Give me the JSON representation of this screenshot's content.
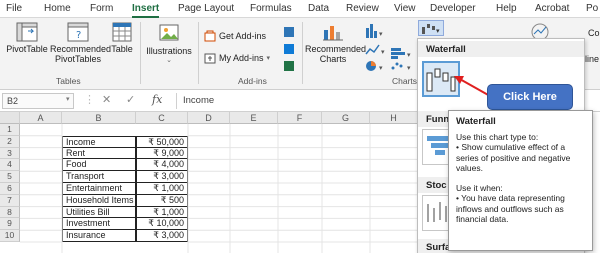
{
  "tabs": [
    "File",
    "Home",
    "Form",
    "Insert",
    "Page Layout",
    "Formulas",
    "Data",
    "Review",
    "View",
    "Developer",
    "Help",
    "Acrobat",
    "Po"
  ],
  "ribbon": {
    "pivottable": "PivotTable",
    "recommended_pivottables": "Recommended PivotTables",
    "table": "Table",
    "illustrations": "Illustrations",
    "get_addins": "Get Add-ins",
    "my_addins": "My Add-ins",
    "recommended_charts": "Recommended Charts",
    "groups": {
      "tables": "Tables",
      "addins": "Add-ins",
      "charts": "Charts"
    },
    "partial_line": "line",
    "partial_co": "Co"
  },
  "formula_bar": {
    "name_box": "B2",
    "cancel": "✕",
    "enter": "✓",
    "fx": "fx",
    "content": "Income"
  },
  "columns": [
    "A",
    "B",
    "C",
    "D",
    "E",
    "F",
    "G",
    "H"
  ],
  "rows": [
    "1",
    "2",
    "3",
    "4",
    "5",
    "6",
    "7",
    "8",
    "9",
    "10"
  ],
  "table": [
    {
      "label": "Income",
      "value": "₹ 50,000"
    },
    {
      "label": "Rent",
      "value": "₹ 9,000"
    },
    {
      "label": "Food",
      "value": "₹ 4,000"
    },
    {
      "label": "Transport",
      "value": "₹ 3,000"
    },
    {
      "label": "Entertainment",
      "value": "₹ 1,000"
    },
    {
      "label": "Household Items",
      "value": "₹ 500"
    },
    {
      "label": "Utilities Bill",
      "value": "₹ 1,000"
    },
    {
      "label": "Investment",
      "value": "₹ 10,000"
    },
    {
      "label": "Insurance",
      "value": "₹ 3,000"
    }
  ],
  "dropdown": {
    "waterfall": "Waterfall",
    "funnel": "Funn",
    "stock": "Stoc",
    "surface": "Surface"
  },
  "tooltip": {
    "title": "Waterfall",
    "line1": "Use this chart type to:",
    "line2": "• Show cumulative effect of a series of positive and negative values.",
    "line3": "Use it when:",
    "line4": "• You have data representing inflows and outflows such as financial data."
  },
  "callout": "Click Here",
  "colors": {
    "accent_green": "#1f6f43",
    "callout_blue": "#4472c4",
    "arrow_red": "#e02020"
  }
}
